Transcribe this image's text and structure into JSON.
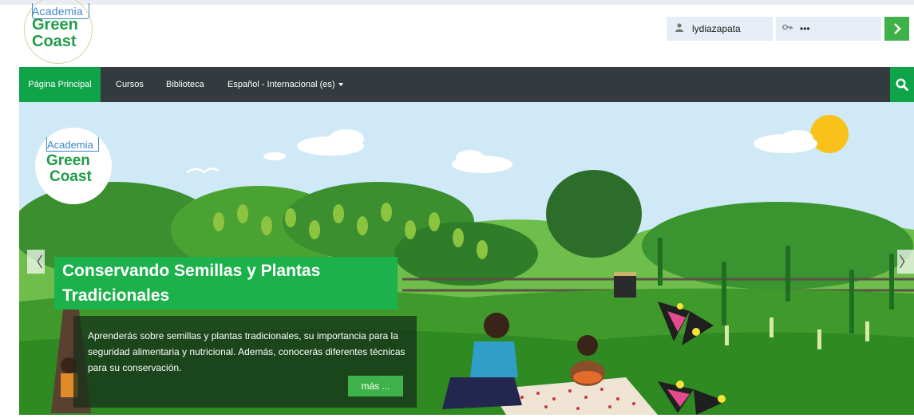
{
  "logo": {
    "line1": "Academia",
    "line2": "Green",
    "line3": "Coast"
  },
  "login": {
    "username": "lydiazapata",
    "password": "•••",
    "submit_icon": "chevron-right"
  },
  "nav": {
    "items": [
      {
        "label": "Página Principal",
        "active": true
      },
      {
        "label": "Cursos"
      },
      {
        "label": "Biblioteca"
      },
      {
        "label": "Español - Internacional (es)"
      }
    ],
    "search_icon": "search"
  },
  "hero": {
    "prev_arrow": "〈",
    "next_arrow": "〉",
    "title": "Conservando Semillas y Plantas Tradicionales",
    "description": "Aprenderás sobre semillas y plantas tradicionales, su importancia para la seguridad alimentaria y nutricional. Además, conocerás diferentes técnicas para su conservación.",
    "more_label": "más ...",
    "colors": {
      "sky": "#cfe9f7",
      "grass": "#3f9a2b",
      "caption": "#1db14b",
      "sun": "#f8c21a"
    }
  }
}
